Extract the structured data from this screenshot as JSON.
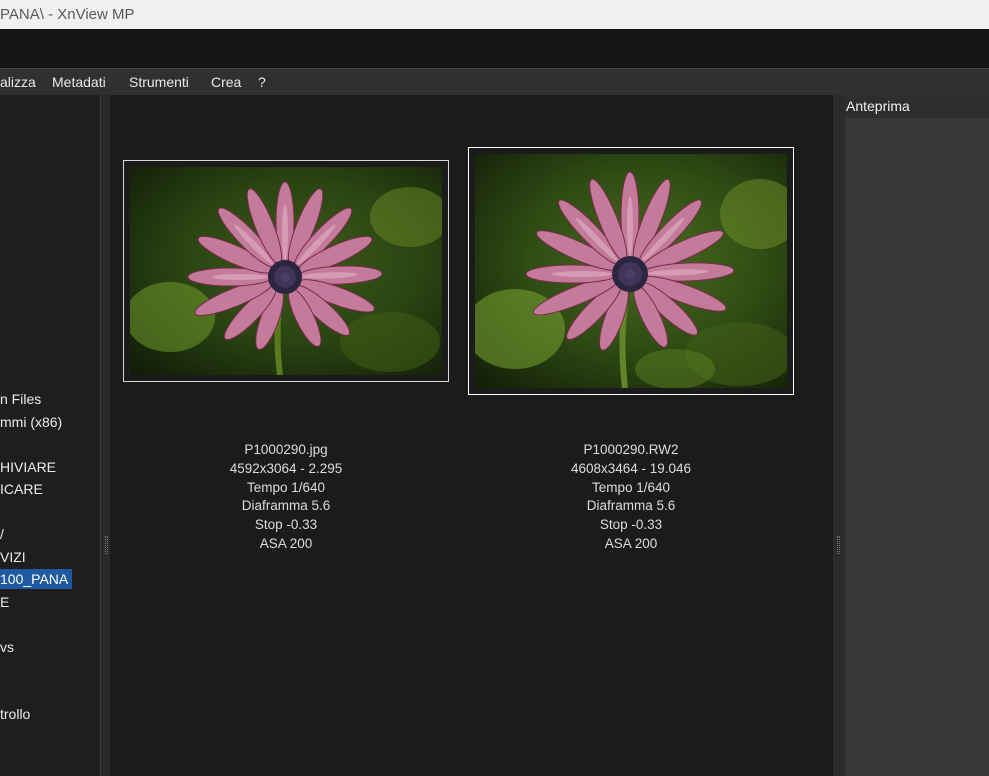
{
  "window": {
    "title": "PANA\\ - XnView MP"
  },
  "menu": {
    "items": [
      {
        "label": "alizza"
      },
      {
        "label": "Metadati"
      },
      {
        "label": "Strumenti"
      },
      {
        "label": "Crea"
      },
      {
        "label": "?"
      }
    ]
  },
  "tree": {
    "items": [
      {
        "label": "n Files"
      },
      {
        "label": "mmi (x86)"
      },
      {
        "label": "HIVIARE"
      },
      {
        "label": "ICARE"
      },
      {
        "label": "/"
      },
      {
        "label": "VIZI"
      },
      {
        "label": "100_PANA",
        "selected": true
      },
      {
        "label": "E"
      },
      {
        "label": "vs"
      },
      {
        "label": "trollo"
      }
    ]
  },
  "browser": {
    "items": [
      {
        "filename": "P1000290.jpg",
        "dimensions": "4592x3064 - 2.295",
        "exposure": "Tempo 1/640",
        "aperture": "Diaframma 5.6",
        "stop": "Stop -0.33",
        "iso": "ASA 200"
      },
      {
        "filename": "P1000290.RW2",
        "dimensions": "4608x3464 - 19.046",
        "exposure": "Tempo 1/640",
        "aperture": "Diaframma 5.6",
        "stop": "Stop -0.33",
        "iso": "ASA 200"
      }
    ]
  },
  "preview": {
    "title": "Anteprima"
  }
}
